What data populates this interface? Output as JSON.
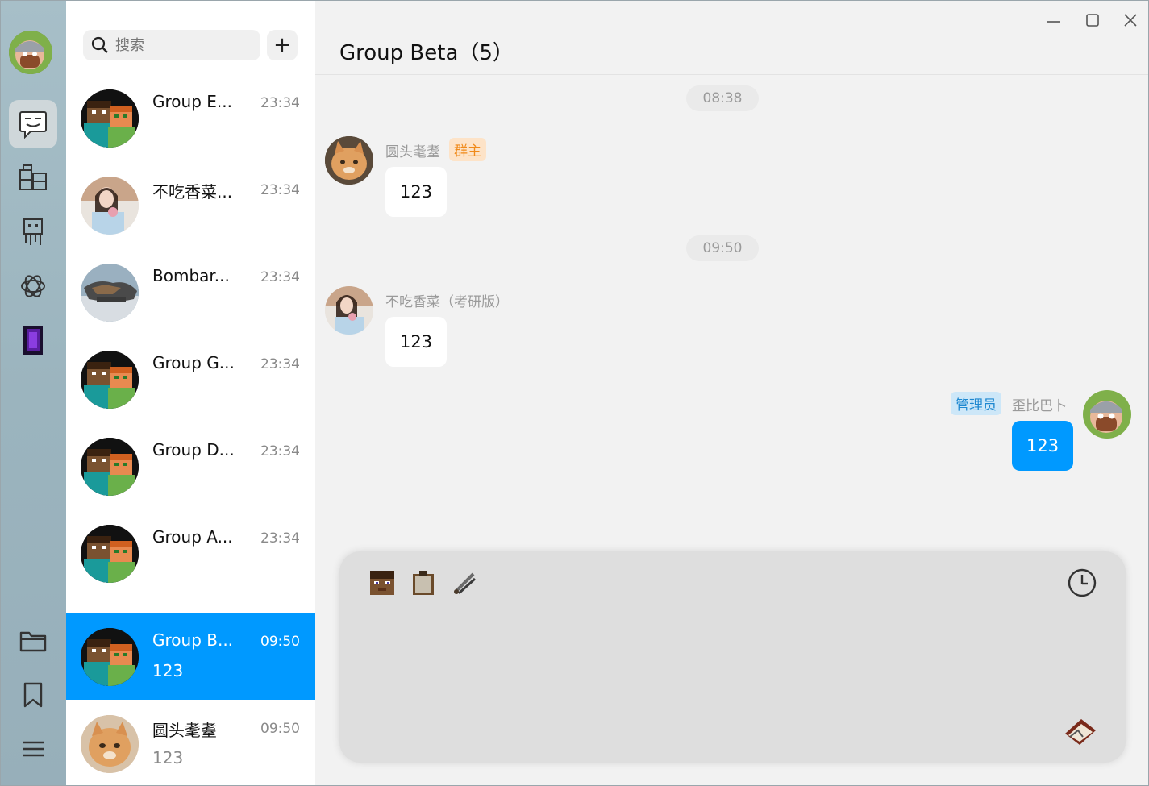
{
  "search": {
    "placeholder": "搜索"
  },
  "list_actions": {
    "add_label": "+"
  },
  "conversations": [
    {
      "name": "Group E...",
      "time": "23:34",
      "preview": ""
    },
    {
      "name": "不吃香菜...",
      "time": "23:34",
      "preview": ""
    },
    {
      "name": "Bombar...",
      "time": "23:34",
      "preview": ""
    },
    {
      "name": "Group G...",
      "time": "23:34",
      "preview": ""
    },
    {
      "name": "Group D...",
      "time": "23:34",
      "preview": ""
    },
    {
      "name": "Group A...",
      "time": "23:34",
      "preview": ""
    },
    {
      "name": "Group B...",
      "time": "09:50",
      "preview": "123",
      "active": true
    },
    {
      "name": "圆头耄耋",
      "time": "09:50",
      "preview": "123"
    }
  ],
  "chat": {
    "title": "Group Beta（5）",
    "messages": [
      {
        "type": "time",
        "text": "08:38"
      },
      {
        "type": "in",
        "sender": "圆头耄耋",
        "badge": "群主",
        "text": "123"
      },
      {
        "type": "time",
        "text": "09:50"
      },
      {
        "type": "in",
        "sender": "不吃香菜（考研版）",
        "text": "123"
      },
      {
        "type": "out",
        "sender": "歪比巴卜",
        "badge": "管理员",
        "text": "123"
      }
    ]
  },
  "window_controls": {
    "minimize": "—",
    "maximize": "☐",
    "close": "✕"
  },
  "colors": {
    "accent": "#0099ff",
    "rail": "#9bb4be",
    "owner_badge": "#f08a1a",
    "admin_badge": "#1e88d0"
  },
  "icons": {
    "rail": [
      "chat-icon",
      "contacts-icon",
      "robot-icon",
      "openai-icon",
      "portal-icon",
      "folder-icon",
      "bookmark-icon",
      "menu-icon"
    ],
    "composer": [
      "steve-head-icon",
      "clipboard-icon",
      "scissors-icon",
      "history-clock-icon",
      "send-book-icon"
    ]
  }
}
